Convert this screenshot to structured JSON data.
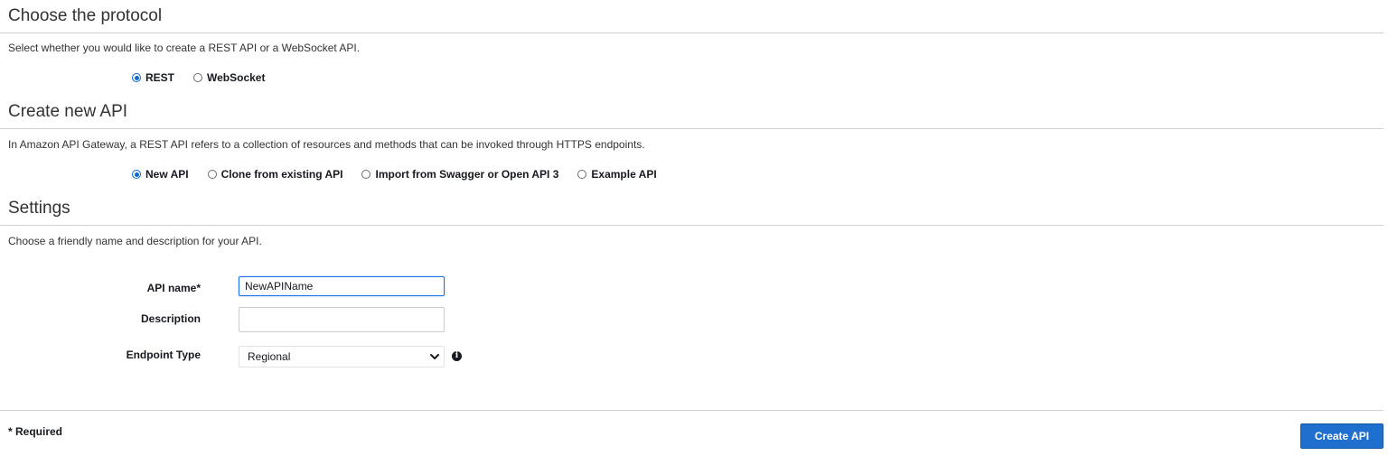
{
  "protocol": {
    "title": "Choose the protocol",
    "description": "Select whether you would like to create a REST API or a WebSocket API.",
    "options": [
      {
        "label": "REST",
        "checked": true
      },
      {
        "label": "WebSocket",
        "checked": false
      }
    ]
  },
  "create_api": {
    "title": "Create new API",
    "description": "In Amazon API Gateway, a REST API refers to a collection of resources and methods that can be invoked through HTTPS endpoints.",
    "options": [
      {
        "label": "New API",
        "checked": true
      },
      {
        "label": "Clone from existing API",
        "checked": false
      },
      {
        "label": "Import from Swagger or Open API 3",
        "checked": false
      },
      {
        "label": "Example API",
        "checked": false
      }
    ]
  },
  "settings": {
    "title": "Settings",
    "description": "Choose a friendly name and description for your API.",
    "api_name_label": "API name*",
    "api_name_value": "NewAPIName",
    "description_label": "Description",
    "description_value": "",
    "endpoint_type_label": "Endpoint Type",
    "endpoint_type_value": "Regional"
  },
  "footer": {
    "required_note": "* Required",
    "create_button": "Create API"
  },
  "colors": {
    "accent": "#0b6ad6",
    "primary_button": "#1f6fcf"
  },
  "icons": {
    "select": "chevron-down-icon",
    "info": "info-icon"
  }
}
